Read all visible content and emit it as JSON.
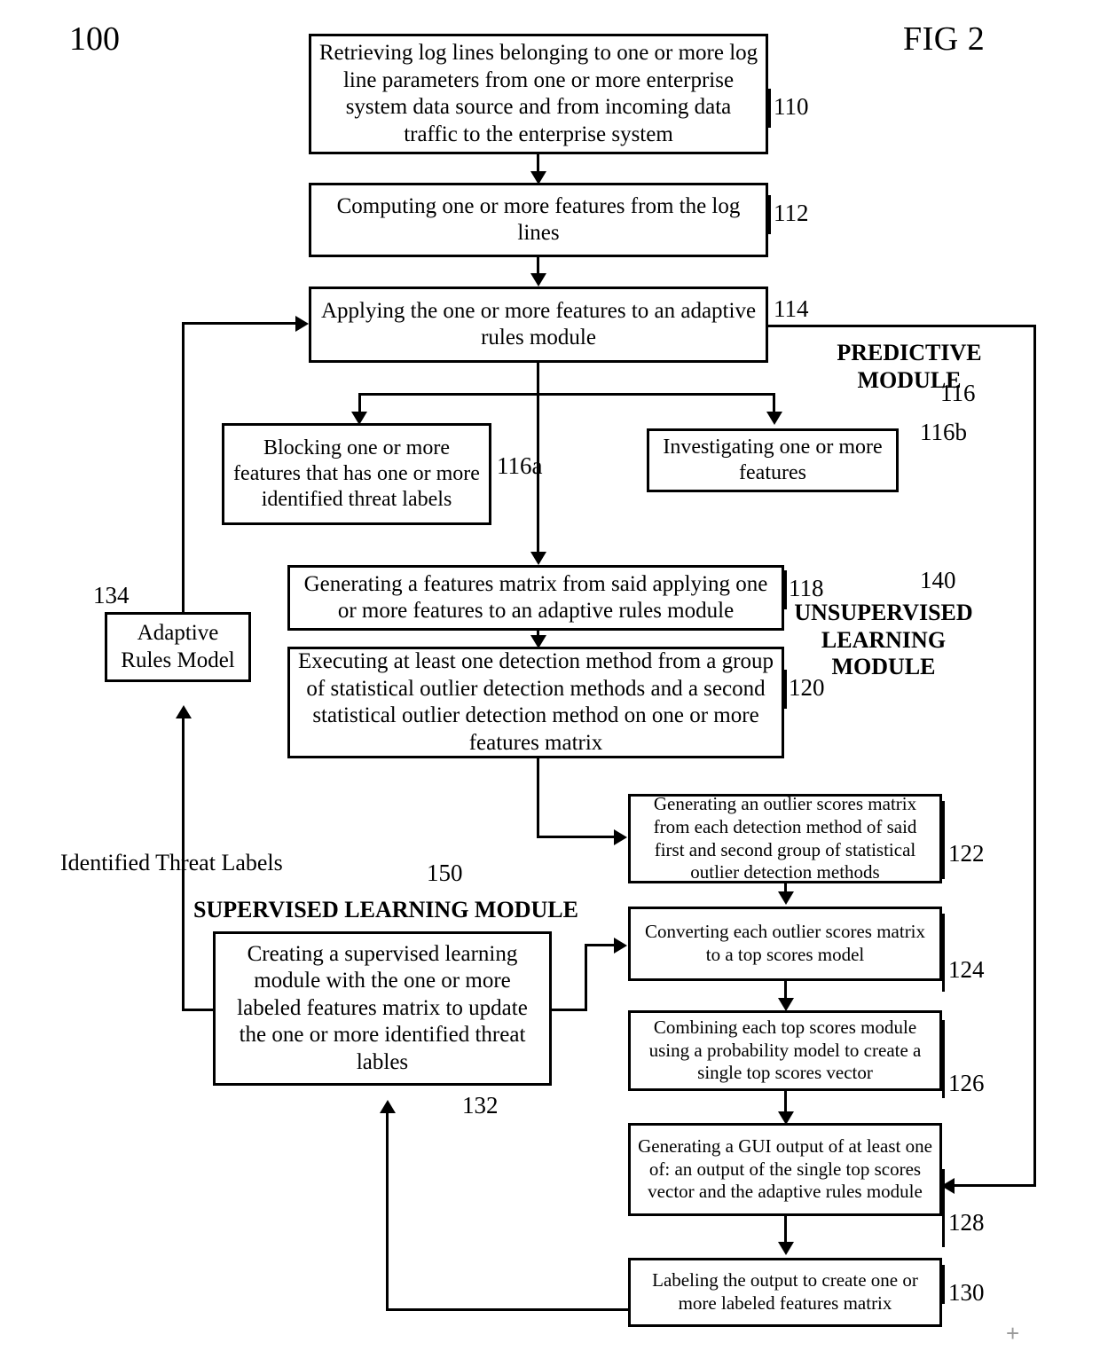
{
  "figure": {
    "number_label": "100",
    "title": "FIG 2"
  },
  "modules": {
    "predictive": {
      "name": "PREDICTIVE\nMODULE",
      "ref": "116"
    },
    "unsupervised": {
      "name": "UNSUPERVISED\nLEARNING\nMODULE",
      "ref": "140"
    },
    "supervised": {
      "name": "SUPERVISED LEARNING MODULE",
      "ref": "150"
    }
  },
  "edge_labels": {
    "identified_threat_labels": "Identified Threat Labels"
  },
  "nodes": {
    "n110": {
      "text": "Retrieving log lines belonging to one or more log line parameters from one or more enterprise system data source and from incoming data traffic to the enterprise system",
      "ref": "110"
    },
    "n112": {
      "text": "Computing one or more features from the log lines",
      "ref": "112"
    },
    "n114": {
      "text": "Applying the one or more features to an adaptive rules module",
      "ref": "114"
    },
    "n116a": {
      "text": "Blocking one or more features that has one or more identified threat labels",
      "ref": "116a"
    },
    "n116b": {
      "text": "Investigating one or more features",
      "ref": "116b"
    },
    "n118": {
      "text": "Generating a features matrix from said applying one or more features to an adaptive rules module",
      "ref": "118"
    },
    "n120": {
      "text": "Executing at least one detection method from a group of statistical outlier detection methods and a second statistical outlier detection method on one or more features matrix",
      "ref": "120"
    },
    "n122": {
      "text": "Generating an outlier scores matrix from each detection method of said first and second group of statistical outlier detection methods",
      "ref": "122"
    },
    "n124": {
      "text": "Converting each outlier scores matrix to a top scores model",
      "ref": "124"
    },
    "n126": {
      "text": "Combining each top scores module using a probability model to create a single top scores vector",
      "ref": "126"
    },
    "n128": {
      "text": "Generating a GUI output of at least one of: an output of the single top scores vector and the adaptive rules module",
      "ref": "128"
    },
    "n130": {
      "text": "Labeling the output to create one or more labeled features matrix",
      "ref": "130"
    },
    "n132": {
      "text": "Creating a supervised learning module with the one or more labeled features matrix to update the one or more identified threat lables",
      "ref": "132"
    },
    "n134": {
      "text": "Adaptive Rules Model",
      "ref": "134"
    }
  },
  "marks": {
    "crosshair": "+"
  },
  "colors": {
    "stroke": "#000000",
    "background": "#ffffff",
    "crosshair": "#999999"
  }
}
